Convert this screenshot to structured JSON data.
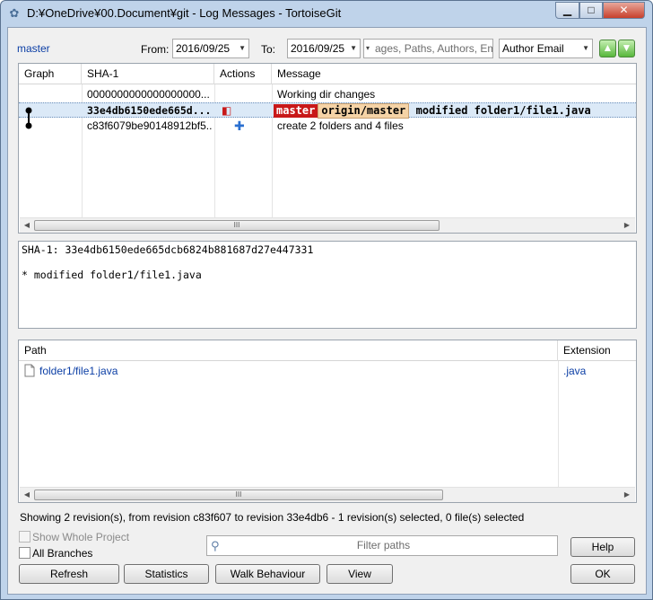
{
  "window": {
    "title": "D:¥OneDrive¥00.Document¥git - Log Messages - TortoiseGit",
    "minimize_glyph": "▁",
    "maximize_glyph": "□",
    "close_glyph": "✕"
  },
  "toolbar": {
    "branch_link": "master",
    "from_label": "From:",
    "from_date": "2016/09/25",
    "to_label": "To:",
    "to_date": "2016/09/25",
    "search_placeholder": "ages, Paths, Authors, Emails,",
    "search_field": "Author Email",
    "up_glyph": "▲",
    "down_glyph": "▼"
  },
  "commits": {
    "columns": [
      "Graph",
      "SHA-1",
      "Actions",
      "Message"
    ],
    "rows": [
      {
        "sha": "0000000000000000000...",
        "message": "Working dir changes",
        "selected": false
      },
      {
        "sha": "33e4db6150ede665d...",
        "message": "modified folder1/file1.java",
        "selected": true,
        "refs": [
          "master",
          "origin/master"
        ]
      },
      {
        "sha": "c83f6079be90148912bf5...",
        "message": "create 2 folders and 4 files",
        "selected": false
      }
    ]
  },
  "detail": {
    "sha_line": "SHA-1: 33e4db6150ede665dcb6824b881687d27e447331",
    "message_line": "* modified folder1/file1.java"
  },
  "files": {
    "columns": [
      "Path",
      "Extension"
    ],
    "rows": [
      {
        "path": "folder1/file1.java",
        "extension": ".java"
      }
    ]
  },
  "scroll_grip": "III",
  "status_text": "Showing 2 revision(s), from revision c83f607 to revision 33e4db6 - 1 revision(s) selected, 0 file(s) selected",
  "options": {
    "show_whole_project": "Show Whole Project",
    "all_branches": "All Branches"
  },
  "filter_placeholder": "Filter paths",
  "buttons": {
    "help": "Help",
    "refresh": "Refresh",
    "statistics": "Statistics",
    "walk_behaviour": "Walk Behaviour",
    "view": "View",
    "ok": "OK"
  },
  "colors": {
    "master_tag": "#c81818",
    "origin_tag": "#f5d3a6",
    "selection": "#dbe9f7",
    "link": "#0b3ea5"
  }
}
